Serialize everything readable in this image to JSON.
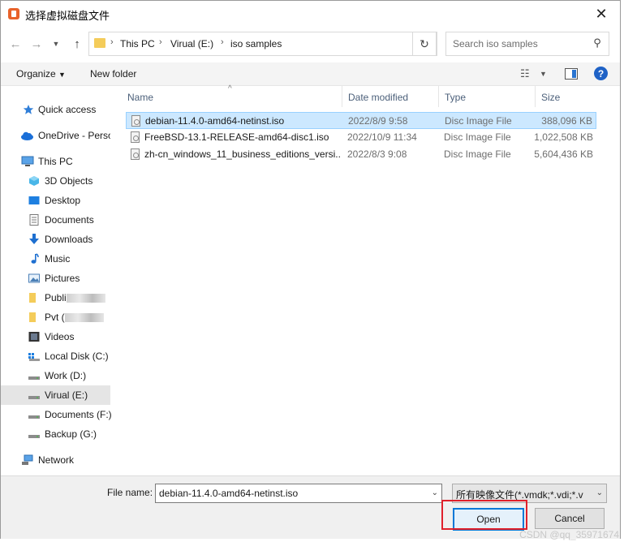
{
  "window": {
    "title": "选择虚拟磁盘文件"
  },
  "address": {
    "crumbs": [
      "This PC",
      "Virual (E:)",
      "iso samples"
    ],
    "search_placeholder": "Search iso samples"
  },
  "toolbar": {
    "organize": "Organize",
    "new_folder": "New folder"
  },
  "sidebar": {
    "items": [
      {
        "label": "Quick access",
        "icon": "star-icon"
      },
      {
        "label": "OneDrive - Perso",
        "icon": "cloud-icon"
      },
      {
        "label": "This PC",
        "icon": "computer-icon"
      },
      {
        "label": "3D Objects",
        "icon": "cube-icon"
      },
      {
        "label": "Desktop",
        "icon": "desktop-icon"
      },
      {
        "label": "Documents",
        "icon": "document-icon"
      },
      {
        "label": "Downloads",
        "icon": "download-icon"
      },
      {
        "label": "Music",
        "icon": "music-icon"
      },
      {
        "label": "Pictures",
        "icon": "picture-icon"
      },
      {
        "label": "Publi",
        "icon": "folder-icon"
      },
      {
        "label": "Pvt (",
        "icon": "folder-icon"
      },
      {
        "label": "Videos",
        "icon": "video-icon"
      },
      {
        "label": "Local Disk (C:)",
        "icon": "drive-icon"
      },
      {
        "label": "Work (D:)",
        "icon": "drive-icon"
      },
      {
        "label": "Virual (E:)",
        "icon": "drive-icon"
      },
      {
        "label": "Documents (F:)",
        "icon": "drive-icon"
      },
      {
        "label": "Backup (G:)",
        "icon": "drive-icon"
      },
      {
        "label": "Network",
        "icon": "network-icon"
      }
    ]
  },
  "columns": {
    "name": "Name",
    "date": "Date modified",
    "type": "Type",
    "size": "Size"
  },
  "files": [
    {
      "name": "debian-11.4.0-amd64-netinst.iso",
      "date": "2022/8/9 9:58",
      "type": "Disc Image File",
      "size": "388,096 KB",
      "selected": true
    },
    {
      "name": "FreeBSD-13.1-RELEASE-amd64-disc1.iso",
      "date": "2022/10/9 11:34",
      "type": "Disc Image File",
      "size": "1,022,508 KB",
      "selected": false
    },
    {
      "name": "zh-cn_windows_11_business_editions_versi...",
      "date": "2022/8/3 9:08",
      "type": "Disc Image File",
      "size": "5,604,436 KB",
      "selected": false
    }
  ],
  "footer": {
    "file_name_label": "File name:",
    "file_name_value": "debian-11.4.0-amd64-netinst.iso",
    "file_type_value": "所有映像文件(*.vmdk;*.vdi;*.v",
    "open_label": "Open",
    "cancel_label": "Cancel"
  },
  "watermark": "CSDN @qq_35971674",
  "colors": {
    "accent": "#0078d7",
    "selection": "#cce8ff",
    "highlight_box": "#e0202b"
  }
}
